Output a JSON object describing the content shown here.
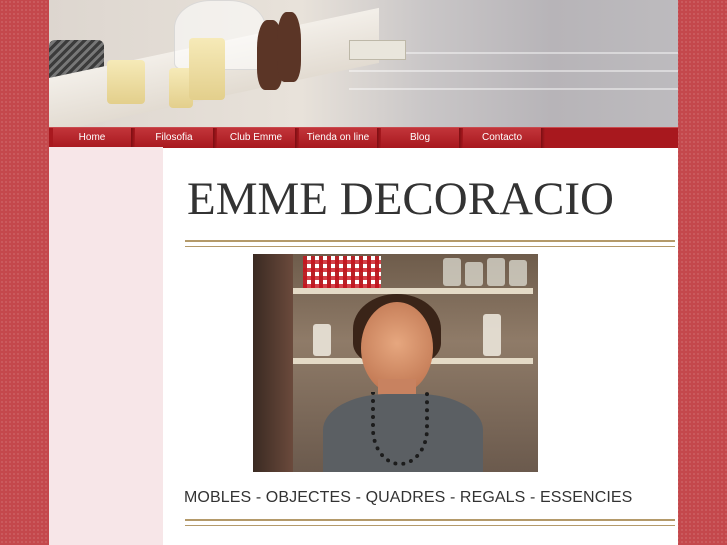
{
  "nav": {
    "items": [
      {
        "label": "Home"
      },
      {
        "label": "Filosofia"
      },
      {
        "label": "Club Emme"
      },
      {
        "label": "Tienda on line"
      },
      {
        "label": "Blog"
      },
      {
        "label": "Contacto"
      }
    ]
  },
  "site": {
    "title": "EMME DECORACIO",
    "tagline": "MOBLES - OBJECTES - QUADRES - REGALS - ESSENCIES"
  },
  "colors": {
    "background": "#c4484c",
    "nav": "#a8181e",
    "sidebar": "#f7e6e8",
    "rule": "#b49a6a"
  }
}
